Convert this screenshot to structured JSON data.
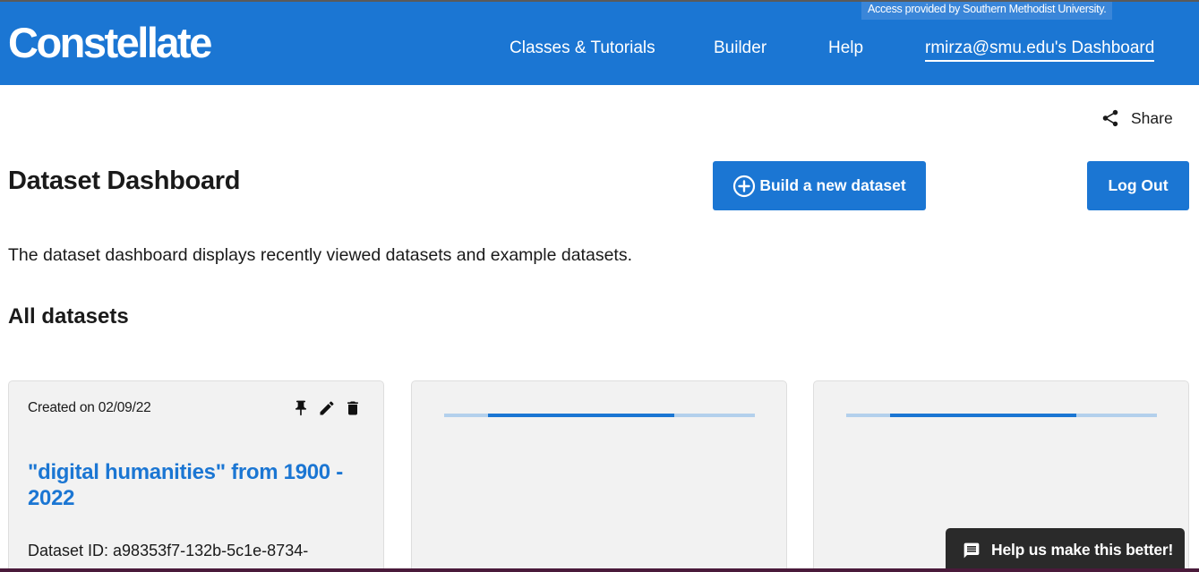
{
  "header": {
    "logo": "Constellate",
    "access_notice": "Access provided by Southern Methodist University.",
    "nav": {
      "classes": "Classes & Tutorials",
      "builder": "Builder",
      "help": "Help",
      "dashboard": "rmirza@smu.edu's Dashboard"
    }
  },
  "share": {
    "label": "Share",
    "icon": "share-icon"
  },
  "page": {
    "title": "Dataset Dashboard",
    "build_button": "Build a new dataset",
    "logout_button": "Log Out",
    "description": "The dataset dashboard displays recently viewed datasets and example datasets.",
    "section_title": "All datasets"
  },
  "cards": [
    {
      "created": "Created on 02/09/22",
      "title": "\"digital humanities\" from 1900 - 2022",
      "dataset_id": "Dataset ID: a98353f7-132b-5c1e-8734-",
      "actions": [
        "pin-icon",
        "edit-icon",
        "delete-icon"
      ]
    }
  ],
  "feedback": {
    "label": "Help us make this better!",
    "icon": "feedback-icon"
  },
  "colors": {
    "brand": "#1b76d3",
    "feedback_bg": "#2a2a2a",
    "card_bg": "#f2f2f2"
  }
}
